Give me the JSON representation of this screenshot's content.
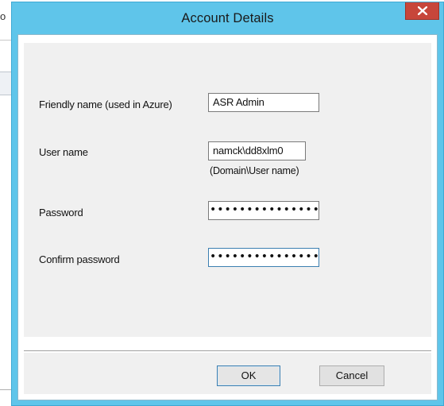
{
  "background_window": {
    "title_fragment": "o"
  },
  "dialog": {
    "title": "Account Details",
    "close_glyph": "x"
  },
  "form": {
    "friendly_name": {
      "label": "Friendly name (used in Azure)",
      "value": "ASR Admin"
    },
    "user_name": {
      "label": "User name",
      "value": "namck\\dd8xlm0",
      "hint": "(Domain\\User name)"
    },
    "password": {
      "label": "Password",
      "value": "•••••••••••••••"
    },
    "confirm_password": {
      "label": "Confirm password",
      "value": "•••••••••••••••"
    }
  },
  "buttons": {
    "ok_label": "OK",
    "cancel_label": "Cancel"
  },
  "colors": {
    "titlebar": "#5fc5ea",
    "close_button": "#c7463a",
    "panel": "#f0f0f0",
    "focus_border": "#3c7fb1"
  }
}
